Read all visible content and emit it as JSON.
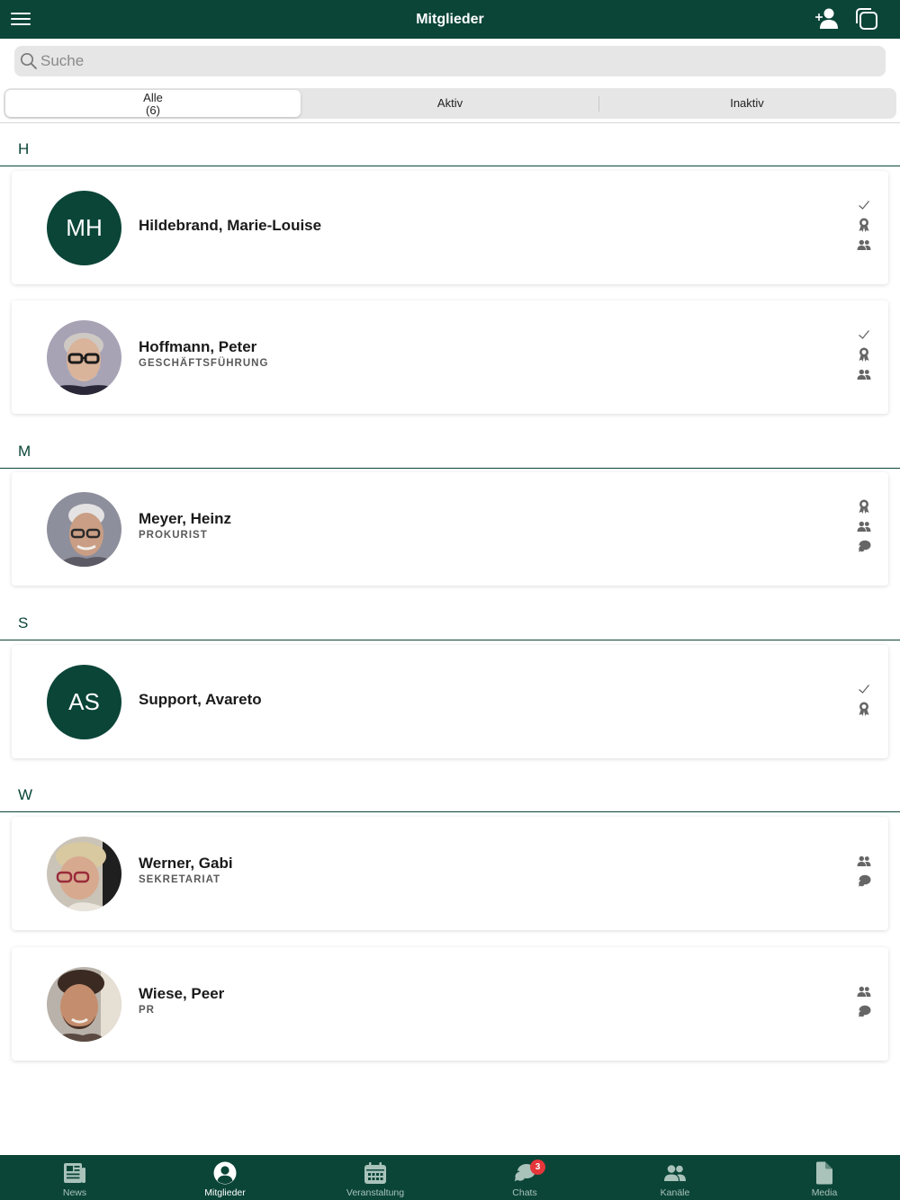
{
  "header": {
    "title": "Mitglieder",
    "menu_icon": "hamburger-menu-icon",
    "add_member_icon": "add-person-icon",
    "copy_icon": "copy-icon"
  },
  "search": {
    "placeholder": "Suche",
    "value": "",
    "icon": "search-icon"
  },
  "filter_tabs": [
    {
      "label": "Alle",
      "count": "(6)",
      "selected": true
    },
    {
      "label": "Aktiv",
      "selected": false
    },
    {
      "label": "Inaktiv",
      "selected": false
    }
  ],
  "sections": [
    {
      "letter": "H"
    },
    {
      "letter": "M"
    },
    {
      "letter": "S"
    },
    {
      "letter": "W"
    }
  ],
  "members": [
    {
      "name": "Hildebrand, Marie-Louise",
      "role": "",
      "initials": "MH",
      "status_icons": [
        "checkmark-icon",
        "award-icon",
        "group-icon"
      ]
    },
    {
      "name": "Hoffmann, Peter",
      "role": "GESCHÄFTSFÜHRUNG",
      "initials": "",
      "status_icons": [
        "checkmark-icon",
        "award-icon",
        "group-icon"
      ]
    },
    {
      "name": "Meyer, Heinz",
      "role": "PROKURIST",
      "initials": "",
      "status_icons": [
        "award-icon",
        "group-icon",
        "chat-icon"
      ]
    },
    {
      "name": "Support, Avareto",
      "role": "",
      "initials": "AS",
      "status_icons": [
        "checkmark-icon",
        "award-icon"
      ]
    },
    {
      "name": "Werner, Gabi",
      "role": "SEKRETARIAT",
      "initials": "",
      "status_icons": [
        "group-icon",
        "chat-icon"
      ]
    },
    {
      "name": "Wiese, Peer",
      "role": "PR",
      "initials": "",
      "status_icons": [
        "group-icon",
        "chat-icon"
      ]
    }
  ],
  "bottom_nav": [
    {
      "label": "News",
      "icon": "news-icon",
      "active": false
    },
    {
      "label": "Mitglieder",
      "icon": "person-circle-icon",
      "active": true
    },
    {
      "label": "Veranstaltung",
      "icon": "calendar-icon",
      "active": false
    },
    {
      "label": "Chats",
      "icon": "chat-bubbles-icon",
      "active": false,
      "badge": "3"
    },
    {
      "label": "Kanäle",
      "icon": "group-icon",
      "active": false
    },
    {
      "label": "Media",
      "icon": "document-icon",
      "active": false
    }
  ],
  "colors": {
    "primary": "#0b4538",
    "badge": "#e5363a",
    "nav_inactive_text": "#a9c3bb"
  }
}
